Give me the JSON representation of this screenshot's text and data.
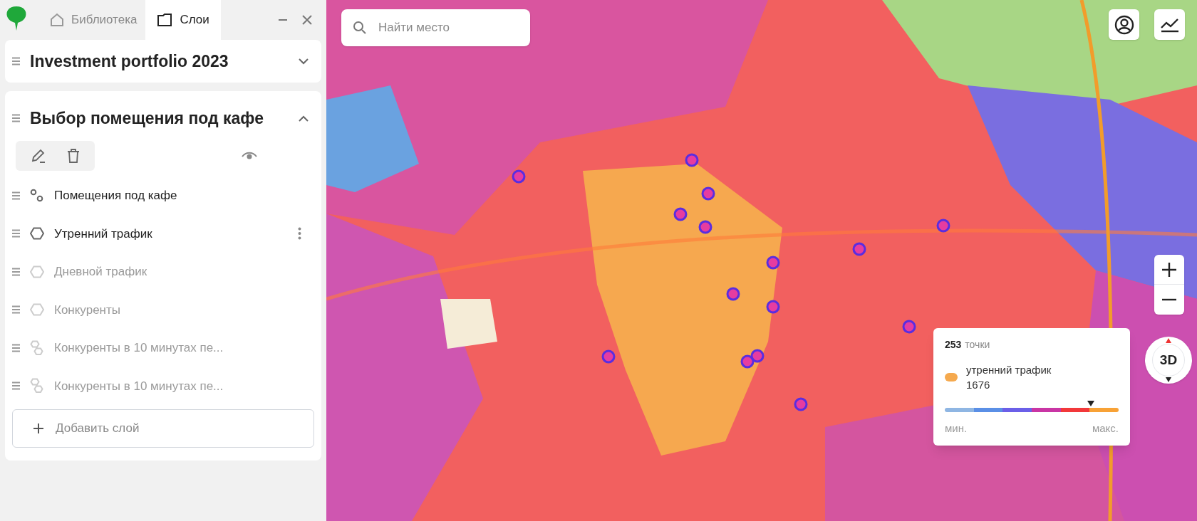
{
  "tabs": [
    {
      "label": "Библиотека",
      "kind": "home",
      "selected": false
    },
    {
      "label": "Слои",
      "kind": "folder",
      "selected": true
    }
  ],
  "projects": [
    {
      "title": "Investment portfolio 2023",
      "expanded": false
    },
    {
      "title": "Выбор помещения под кафе",
      "expanded": true
    }
  ],
  "layers": [
    {
      "name": "Помещения под кафе",
      "kind": "points",
      "visible": true,
      "menu": false
    },
    {
      "name": "Утренний трафик",
      "kind": "hex",
      "visible": true,
      "menu": true
    },
    {
      "name": "Дневной трафик",
      "kind": "hex",
      "visible": false,
      "menu": false
    },
    {
      "name": "Конкуренты",
      "kind": "hex",
      "visible": false,
      "menu": false
    },
    {
      "name": "Конкуренты в 10 минутах пе...",
      "kind": "isochrone",
      "visible": false,
      "menu": false
    },
    {
      "name": "Конкуренты в 10 минутах пе...",
      "kind": "isochrone",
      "visible": false,
      "menu": false
    }
  ],
  "add_layer": "Добавить слой",
  "search": {
    "placeholder": "Найти место"
  },
  "compass": "3D",
  "legend": {
    "count": "253",
    "unit": "точки",
    "label": "утренний трафик",
    "value": "1676",
    "color": "#f5a94e",
    "level": 0.84,
    "stops": [
      {
        "color": "#8fb6e3"
      },
      {
        "color": "#5a8fe6"
      },
      {
        "color": "#6b5fe8"
      },
      {
        "color": "#c935a4"
      },
      {
        "color": "#f2383a"
      },
      {
        "color": "#f8a236"
      }
    ],
    "min": "мин.",
    "max": "макс."
  }
}
